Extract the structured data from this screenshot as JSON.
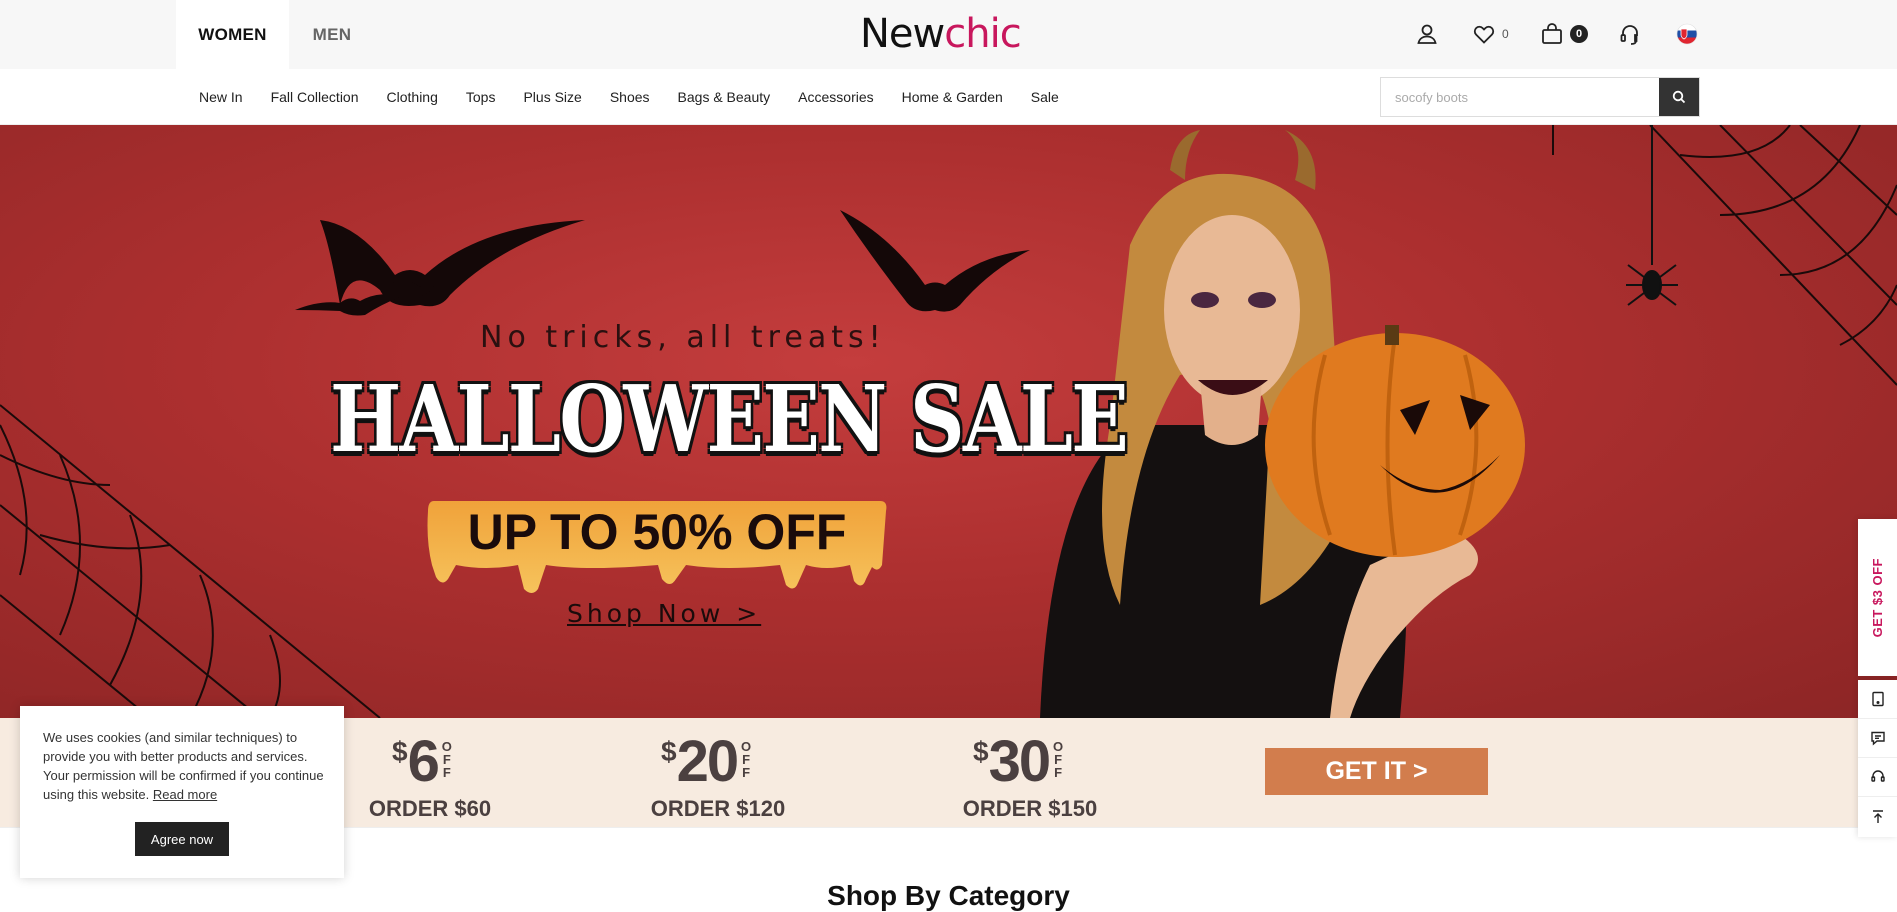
{
  "header": {
    "tabs": [
      {
        "label": "WOMEN",
        "active": true
      },
      {
        "label": "MEN",
        "active": false
      }
    ],
    "logo": {
      "part1": "New",
      "part2": "chic"
    },
    "wishlist_count": "0",
    "cart_count": "0",
    "icons": [
      "user-icon",
      "heart-icon",
      "bag-icon",
      "headset-icon",
      "slovakia-flag-icon"
    ]
  },
  "nav": {
    "items": [
      "New In",
      "Fall Collection",
      "Clothing",
      "Tops",
      "Plus Size",
      "Shoes",
      "Bags & Beauty",
      "Accessories",
      "Home & Garden",
      "Sale"
    ],
    "search_placeholder": "socofy boots"
  },
  "hero": {
    "tagline": "No tricks, all treats!",
    "headline": "HALLOWEEN SALE",
    "discount": "UP TO 50% OFF",
    "cta": "Shop Now >"
  },
  "coupons": [
    {
      "currency": "$",
      "amount": "6",
      "off": [
        "O",
        "F",
        "F"
      ],
      "order": "ORDER $60"
    },
    {
      "currency": "$",
      "amount": "20",
      "off": [
        "O",
        "F",
        "F"
      ],
      "order": "ORDER $120"
    },
    {
      "currency": "$",
      "amount": "30",
      "off": [
        "O",
        "F",
        "F"
      ],
      "order": "ORDER $150"
    }
  ],
  "get_it": "GET IT >",
  "section_title": "Shop By Category",
  "cookie": {
    "text": "We uses cookies (and similar techniques) to provide you with better products and services. Your permission will be confirmed if you continue using this website.",
    "link": "Read more",
    "button": "Agree now"
  },
  "side": {
    "promo": "GET $3 OFF",
    "tools": [
      "app-download-icon",
      "message-icon",
      "support-icon",
      "back-to-top-icon"
    ]
  },
  "colors": {
    "brand": "#c8175d",
    "banner": "#b23232",
    "coupon_bg": "#f7ebe0",
    "get_it": "#d27d4d"
  }
}
